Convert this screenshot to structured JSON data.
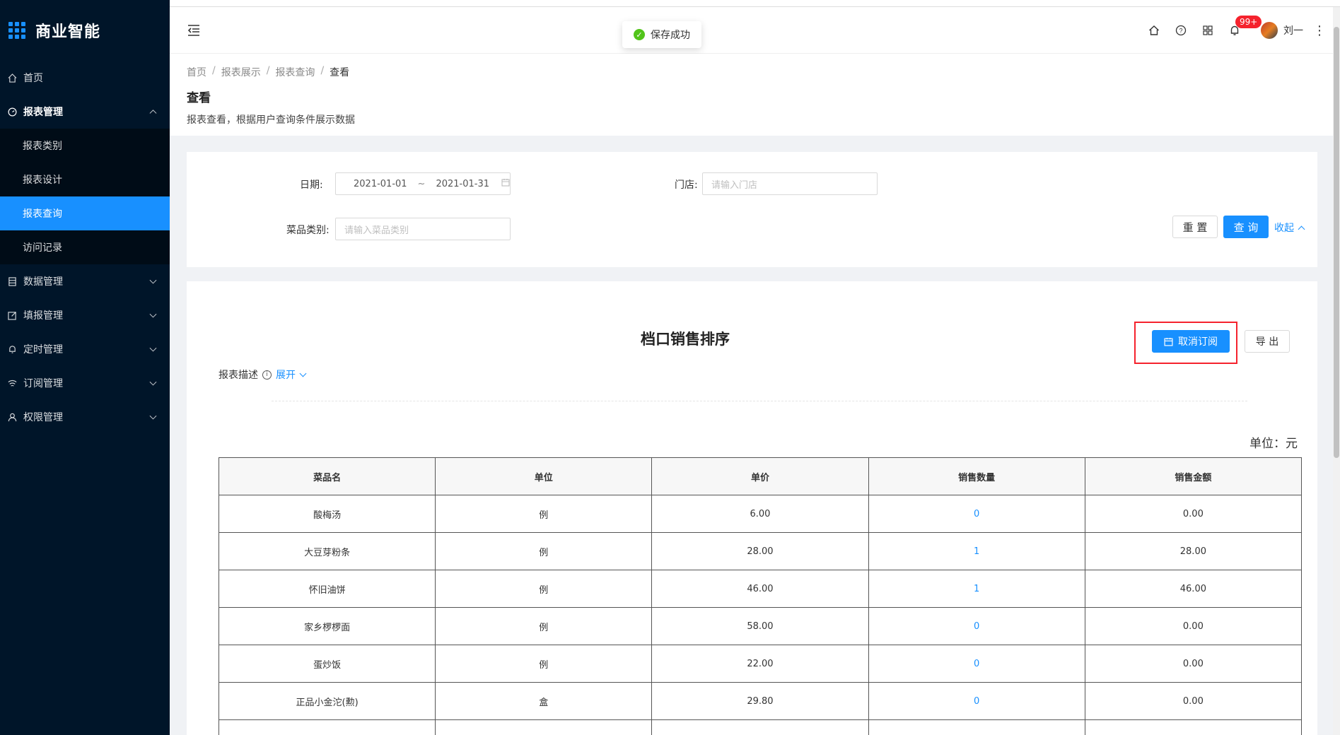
{
  "app": {
    "title": "商业智能"
  },
  "sidebar": {
    "items": [
      {
        "label": "首页",
        "icon": "home-icon"
      },
      {
        "label": "报表管理",
        "icon": "dashboard-icon",
        "expanded": true,
        "children": [
          {
            "label": "报表类别"
          },
          {
            "label": "报表设计"
          },
          {
            "label": "报表查询",
            "active": true
          },
          {
            "label": "访问记录"
          }
        ]
      },
      {
        "label": "数据管理",
        "icon": "database-icon"
      },
      {
        "label": "填报管理",
        "icon": "edit-icon"
      },
      {
        "label": "定时管理",
        "icon": "bell-icon"
      },
      {
        "label": "订阅管理",
        "icon": "wifi-icon"
      },
      {
        "label": "权限管理",
        "icon": "user-icon"
      }
    ]
  },
  "header": {
    "toast": "保存成功",
    "notification_badge": "99+",
    "user_name": "刘一"
  },
  "breadcrumb": [
    "首页",
    "报表展示",
    "报表查询",
    "查看"
  ],
  "page": {
    "title": "查看",
    "description": "报表查看，根据用户查询条件展示数据"
  },
  "filters": {
    "date_label": "日期:",
    "date_start": "2021-01-01",
    "date_sep": "~",
    "date_end": "2021-01-31",
    "store_label": "门店:",
    "store_placeholder": "请输入门店",
    "category_label": "菜品类别:",
    "category_placeholder": "请输入菜品类别",
    "reset_label": "重 置",
    "query_label": "查 询",
    "collapse_label": "收起"
  },
  "report": {
    "title": "档口销售排序",
    "unsubscribe_label": "取消订阅",
    "export_label": "导 出",
    "desc_label": "报表描述",
    "expand_label": "展开",
    "unit_label": "单位：元",
    "columns": [
      "菜品名",
      "单位",
      "单价",
      "销售数量",
      "销售金额"
    ],
    "rows": [
      [
        "酸梅汤",
        "例",
        "6.00",
        "0",
        "0.00"
      ],
      [
        "大豆芽粉条",
        "例",
        "28.00",
        "1",
        "28.00"
      ],
      [
        "怀旧油饼",
        "例",
        "46.00",
        "1",
        "46.00"
      ],
      [
        "家乡椤椤面",
        "例",
        "58.00",
        "0",
        "0.00"
      ],
      [
        "蛋炒饭",
        "例",
        "22.00",
        "0",
        "0.00"
      ],
      [
        "正品小金沱(勲)",
        "盒",
        "29.80",
        "0",
        "0.00"
      ],
      [
        "",
        "",
        "",
        "",
        ""
      ]
    ]
  },
  "colors": {
    "sidebar_bg": "#001529",
    "accent": "#1890ff",
    "highlight": "#f5222d",
    "success": "#52c41a"
  }
}
